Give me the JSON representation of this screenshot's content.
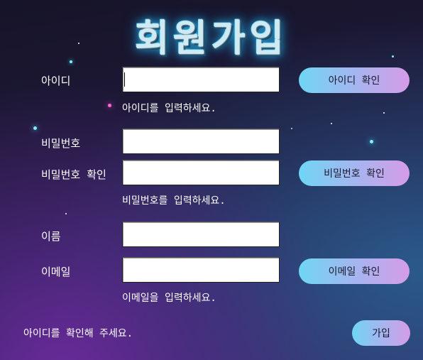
{
  "title": "회원가입",
  "labels": {
    "id": "아이디",
    "password": "비밀번호",
    "password_confirm": "비밀번호 확인",
    "name": "이름",
    "email": "이메일"
  },
  "values": {
    "id": "",
    "password": "",
    "password_confirm": "",
    "name": "",
    "email": ""
  },
  "hints": {
    "id": "아이디를 입력하세요.",
    "password": "비밀번호를 입력하세요.",
    "email": "이메일을 입력하세요."
  },
  "buttons": {
    "check_id": "아이디 확인",
    "check_password": "비밀번호 확인",
    "check_email": "이메일 확인",
    "submit": "가입"
  },
  "status": "아이디를 확인해 주세요.",
  "colors": {
    "button_start": "#6fd6f4",
    "button_end": "#d69ce8",
    "title_glow": "#29c6ff"
  }
}
